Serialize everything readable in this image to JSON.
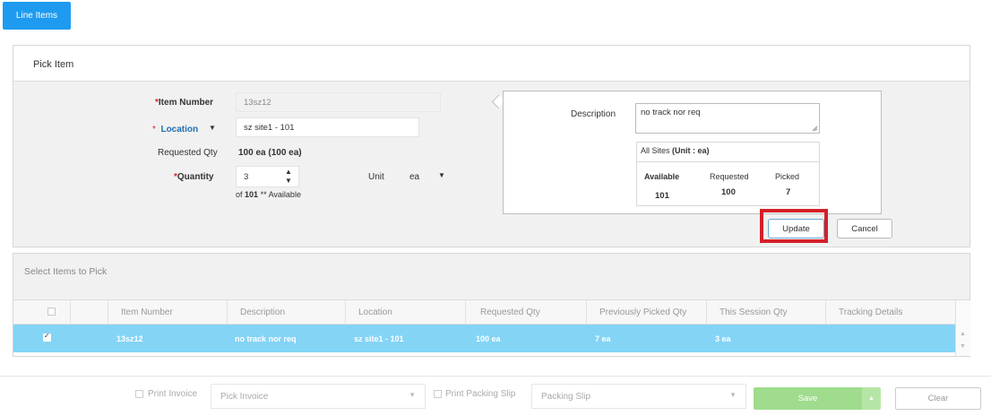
{
  "tabs": {
    "line_items": "Line Items"
  },
  "pick_item": {
    "title": "Pick Item",
    "item_number_label": "Item Number",
    "item_number_value": "13sz12",
    "location_label": "Location",
    "location_value": "sz site1 - 101",
    "requested_qty_label": "Requested Qty",
    "requested_qty_value": "100 ea (100 ea)",
    "quantity_label": "Quantity",
    "quantity_value": "3",
    "availability_prefix": "of",
    "availability_count": "101",
    "availability_suffix": "** Available",
    "unit_label": "Unit",
    "unit_value": "ea",
    "required_mark": "*",
    "description_label": "Description",
    "description_value": "no track nor req",
    "sites_label": "All Sites",
    "sites_unit": "(Unit : ea)",
    "stats": {
      "available_label": "Available",
      "available_value": "101",
      "requested_label": "Requested",
      "requested_value": "100",
      "picked_label": "Picked",
      "picked_value": "7"
    },
    "update_button": "Update",
    "cancel_button": "Cancel"
  },
  "select_items": {
    "title": "Select Items to Pick",
    "columns": [
      "Item Number",
      "Description",
      "Location",
      "Requested Qty",
      "Previously Picked Qty",
      "This Session Qty",
      "Tracking Details"
    ],
    "rows": [
      {
        "item_number": "13sz12",
        "description": "no track nor req",
        "location": "sz site1 - 101",
        "requested_qty": "100 ea",
        "previously_picked_qty": "7 ea",
        "this_session_qty": "3 ea",
        "tracking_details": "",
        "checked": true
      }
    ]
  },
  "footer": {
    "print_invoice_label": "Print Invoice",
    "pick_invoice_placeholder": "Pick Invoice",
    "print_packing_slip_label": "Print Packing Slip",
    "packing_slip_placeholder": "Packing Slip",
    "save_button": "Save",
    "clear_button": "Clear"
  },
  "colors": {
    "primary": "#1e9bf0",
    "selected_row": "#84d4f6",
    "save": "#9fdc8d",
    "highlight": "#d42028",
    "required": "#d9232d",
    "location_label": "#1f6fb5"
  },
  "icons": [
    "dropdown-caret-icon",
    "spinner-up-icon",
    "spinner-down-icon",
    "resize-grip-icon",
    "checkbox-icon",
    "scroll-up-icon",
    "scroll-down-icon"
  ]
}
